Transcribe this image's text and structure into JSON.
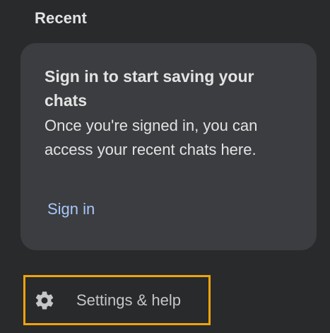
{
  "sidebar": {
    "section_title": "Recent",
    "signin_card": {
      "heading": "Sign in to start saving your chats",
      "body": "Once you're signed in, you can access your recent chats here.",
      "link_label": "Sign in"
    },
    "settings": {
      "label": "Settings & help",
      "icon": "gear-icon"
    }
  },
  "colors": {
    "background": "#282a2c",
    "card": "#3c3d40",
    "link": "#a8c7fa",
    "highlight_border": "#f0a30a"
  }
}
